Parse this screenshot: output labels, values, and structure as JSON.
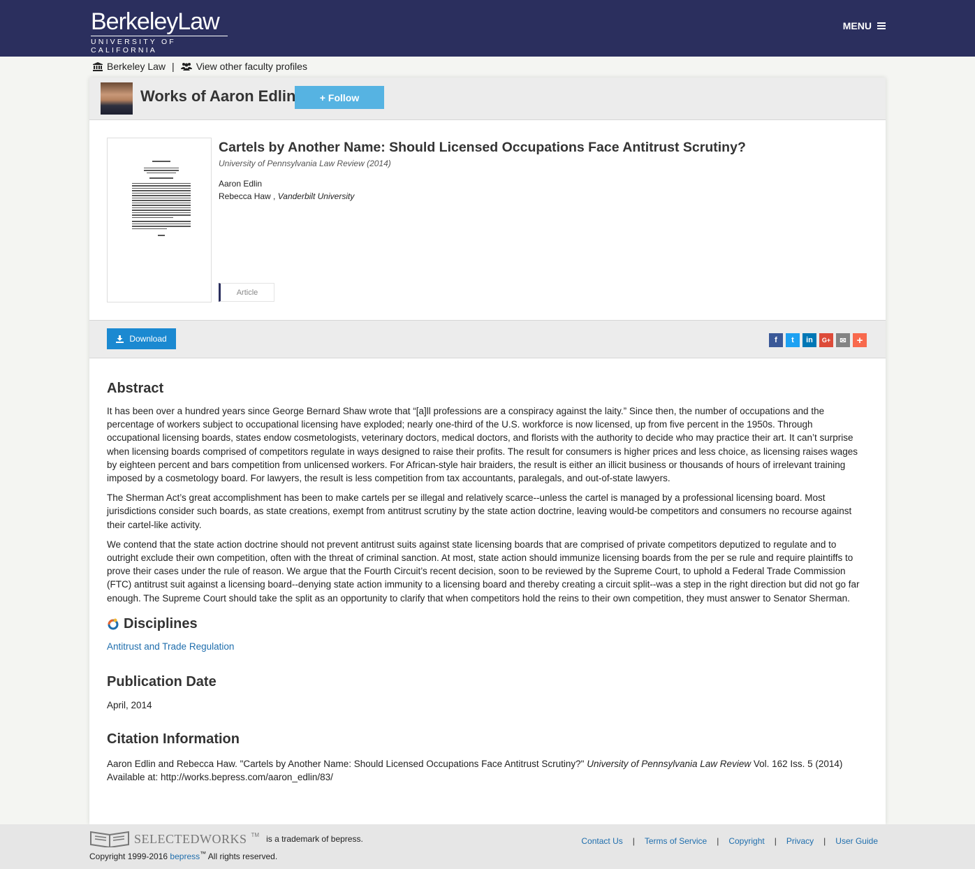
{
  "header": {
    "logo_main": "BerkeleyLaw",
    "logo_sub": "UNIVERSITY OF CALIFORNIA",
    "menu_label": "MENU"
  },
  "breadcrumb": {
    "home_label": "Berkeley Law",
    "separator": "|",
    "profiles_label": "View other faculty profiles"
  },
  "profile": {
    "title": "Works of Aaron Edlin",
    "follow_label": "Follow"
  },
  "article": {
    "title": "Cartels by Another Name: Should Licensed Occupations Face Antitrust Scrutiny?",
    "journal": "University of Pennsylvania Law Review (2014)",
    "author1": "Aaron Edlin",
    "author2_name": "Rebecca Haw",
    "author2_affiliation": "Vanderbilt University",
    "type": "Article"
  },
  "actions": {
    "download_label": "Download",
    "share_icons": [
      "facebook-icon",
      "twitter-icon",
      "linkedin-icon",
      "google-plus-icon",
      "email-icon",
      "more-share-icon"
    ]
  },
  "abstract": {
    "heading": "Abstract",
    "paragraphs": [
      "It has been over a hundred years since George Bernard Shaw wrote that “[a]ll professions are a conspiracy against the laity.” Since then, the number of occupations and the percentage of workers subject to occupational licensing have exploded; nearly one-third of the U.S. workforce is now licensed, up from five percent in the 1950s. Through occupational licensing boards, states endow cosmetologists, veterinary doctors, medical doctors, and florists with the authority to decide who may practice their art. It can’t surprise when licensing boards comprised of competitors regulate in ways designed to raise their profits. The result for consumers is higher prices and less choice, as licensing raises wages by eighteen percent and bars competition from unlicensed workers. For African-style hair braiders, the result is either an illicit business or thousands of hours of irrelevant training imposed by a cosmetology board. For lawyers, the result is less competition from tax accountants, paralegals, and out-of-state lawyers.",
      "The Sherman Act’s great accomplishment has been to make cartels per se illegal and relatively scarce--unless the cartel is managed by a professional licensing board. Most jurisdictions consider such boards, as state creations, exempt from antitrust scrutiny by the state action doctrine, leaving would-be competitors and consumers no recourse against their cartel-like activity.",
      "We contend that the state action doctrine should not prevent antitrust suits against state licensing boards that are comprised of private competitors deputized to regulate and to outright exclude their own competition, often with the threat of criminal sanction. At most, state action should immunize licensing boards from the per se rule and require plaintiffs to prove their cases under the rule of reason. We argue that the Fourth Circuit’s recent decision, soon to be reviewed by the Supreme Court, to uphold a Federal Trade Commission (FTC) antitrust suit against a licensing board--denying state action immunity to a licensing board and thereby creating a circuit split--was a step in the right direction but did not go far enough. The Supreme Court should take the split as an opportunity to clarify that when competitors hold the reins to their own competition, they must answer to Senator Sherman."
    ]
  },
  "disciplines": {
    "heading": "Disciplines",
    "items": [
      "Antitrust and Trade Regulation"
    ]
  },
  "publication_date": {
    "heading": "Publication Date",
    "value": "April, 2014"
  },
  "citation": {
    "heading": "Citation Information",
    "prefix": "Aaron Edlin and Rebecca Haw. \"Cartels by Another Name: Should Licensed Occupations Face Antitrust Scrutiny?\"",
    "journal": "University of Pennsylvania Law Review",
    "suffix": "Vol. 162 Iss. 5 (2014)",
    "available": "Available at: http://works.bepress.com/aaron_edlin/83/"
  },
  "footer": {
    "brand": "SELECTEDWORKS",
    "tm_text": "is a trademark of bepress.",
    "copyright_prefix": "Copyright 1999-2016",
    "copyright_link": "bepress",
    "copyright_suffix": "All rights reserved.",
    "links": [
      "Contact Us",
      "Terms of Service",
      "Copyright",
      "Privacy",
      "User Guide"
    ]
  },
  "colors": {
    "header_bg": "#2b2f5e",
    "follow_bg": "#56b3e2",
    "download_bg": "#1b89d1",
    "link": "#1f6ead"
  }
}
